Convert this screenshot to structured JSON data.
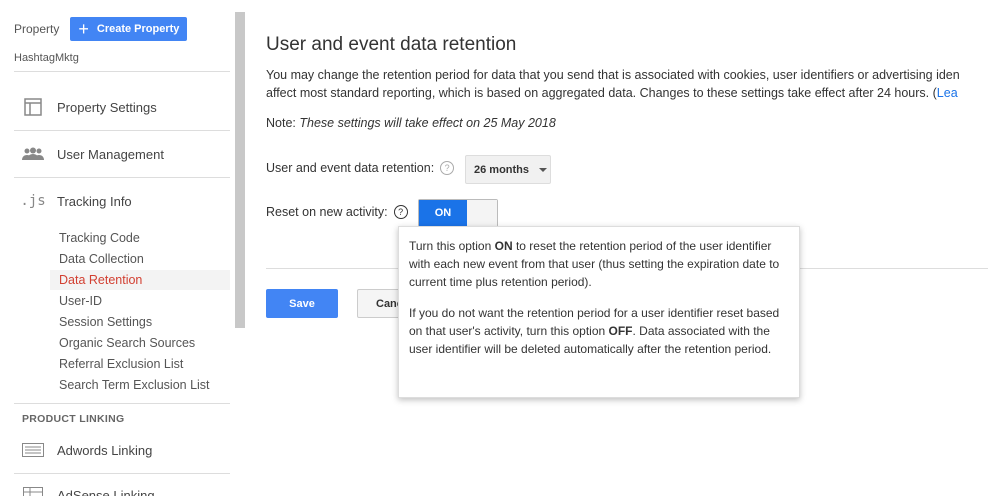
{
  "sidebar": {
    "property_label": "Property",
    "create_property": "Create Property",
    "property_name": "HashtagMktg",
    "nav": [
      {
        "label": "Property Settings",
        "icon": "window-icon"
      },
      {
        "label": "User Management",
        "icon": "people-icon"
      },
      {
        "label": "Tracking Info",
        "icon": "js-icon"
      }
    ],
    "js_text": ".js",
    "tracking_items": [
      "Tracking Code",
      "Data Collection",
      "Data Retention",
      "User-ID",
      "Session Settings",
      "Organic Search Sources",
      "Referral Exclusion List",
      "Search Term Exclusion List"
    ],
    "product_linking": "PRODUCT LINKING",
    "linking_items": [
      "Adwords Linking",
      "AdSense Linking"
    ]
  },
  "main": {
    "title": "User and event data retention",
    "desc_line1": "You may change the retention period for data that you send that is associated with cookies, user identifiers or advertising iden",
    "desc_line2": "affect most standard reporting, which is based on aggregated data. Changes to these settings take effect after 24 hours. (",
    "desc_link": "Lea",
    "note_prefix": "Note:",
    "note_text": "These settings will take effect on 25 May 2018",
    "retention_label": "User and event data retention:",
    "retention_value": "26 months",
    "reset_label": "Reset on new activity:",
    "toggle_on": "ON",
    "save": "Save",
    "cancel": "Cancel"
  },
  "tooltip": {
    "p1_a": "Turn this option ",
    "p1_b": "ON",
    "p1_c": " to reset the retention period of the user identifier with each new event from that user (thus setting the expiration date to current time plus retention period).",
    "p2_a": "If you do not want the retention period for a user identifier reset based on that user's activity, turn this option ",
    "p2_b": "OFF",
    "p2_c": ". Data associated with the user identifier will be deleted automatically after the retention period."
  },
  "colors": {
    "accent": "#4285f4",
    "active": "#d23f31",
    "toggle_on": "#1a73e8"
  }
}
